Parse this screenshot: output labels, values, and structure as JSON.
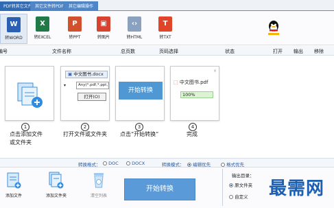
{
  "tabs": [
    "PDF转其它文件",
    "其它文件转PDF",
    "其它编辑操作"
  ],
  "toolbar": [
    {
      "label": "转WORD",
      "icon": "word-icon",
      "color": "#2b5fb4",
      "glyph": "W"
    },
    {
      "label": "转EXCEL",
      "icon": "excel-icon",
      "color": "#1f7a45",
      "glyph": "X"
    },
    {
      "label": "转PPT",
      "icon": "ppt-icon",
      "color": "#d2502b",
      "glyph": "P"
    },
    {
      "label": "转图片",
      "icon": "image-icon",
      "color": "#d8432f",
      "glyph": "▣"
    },
    {
      "label": "转HTML",
      "icon": "html-icon",
      "color": "#8aa2bf",
      "glyph": "‹›"
    },
    {
      "label": "转TXT",
      "icon": "txt-icon",
      "color": "#e0452a",
      "glyph": "T"
    }
  ],
  "columns": [
    "编号",
    "文件名称",
    "总页数",
    "页码选择",
    "状态",
    "打开",
    "输出",
    "移除"
  ],
  "steps": [
    {
      "num": "1",
      "desc1": "点击添加文件",
      "desc2": "或文件夹"
    },
    {
      "num": "2",
      "desc1": "打开文件或文件夹",
      "desc2": ""
    },
    {
      "num": "3",
      "desc1": "点击“开始转换”",
      "desc2": ""
    },
    {
      "num": "4",
      "desc1": "完成",
      "desc2": ""
    }
  ],
  "step2": {
    "filename": "中文图书.docx",
    "filter": "Any(*.pdf,*.ppt,*",
    "open_button": "打开(O)"
  },
  "step3": {
    "button": "开始转换"
  },
  "step4": {
    "filename": "中文图书.pdf",
    "progress": "100%",
    "progress_fraction": 1.0
  },
  "format": {
    "label": "转换格式：",
    "options": [
      "DOC",
      "DOCX"
    ],
    "selected": "DOC",
    "mode_label": "转换模式：",
    "mode_options": [
      "编辑优先",
      "格式优先"
    ],
    "mode_selected": "编辑优先"
  },
  "bottom": {
    "add_file": "添加文件",
    "add_folder": "添加文件夹",
    "clear_list": "清空列表",
    "start": "开始转换",
    "output_label": "输出目录：",
    "output_options": [
      "原文件夹",
      "自定义"
    ],
    "output_selected": "原文件夹"
  },
  "watermark": "最需网"
}
